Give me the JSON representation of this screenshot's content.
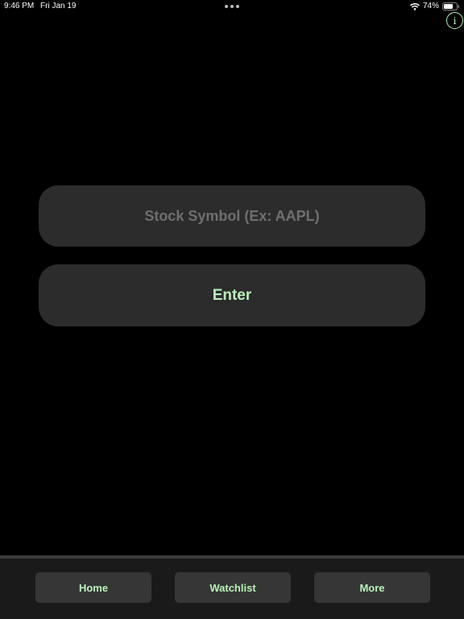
{
  "status_bar": {
    "time": "9:46 PM",
    "date": "Fri Jan 19",
    "battery_percent": "74%",
    "battery_level": 0.74,
    "wifi_icon": "wifi-icon",
    "battery_icon": "battery-icon"
  },
  "header": {
    "info_glyph": "i",
    "info_icon": "info-circle-icon"
  },
  "search": {
    "placeholder": "Stock Symbol (Ex: AAPL)",
    "value": ""
  },
  "actions": {
    "enter_label": "Enter"
  },
  "tabs": [
    {
      "label": "Home"
    },
    {
      "label": "Watchlist"
    },
    {
      "label": "More"
    }
  ],
  "colors": {
    "background": "#000000",
    "accent_text": "#b9f2b9",
    "control_bg": "#2c2c2c",
    "placeholder": "#6f6f6f",
    "tab_bar_bg": "#1a1a1a",
    "tab_button_bg": "#363636"
  }
}
